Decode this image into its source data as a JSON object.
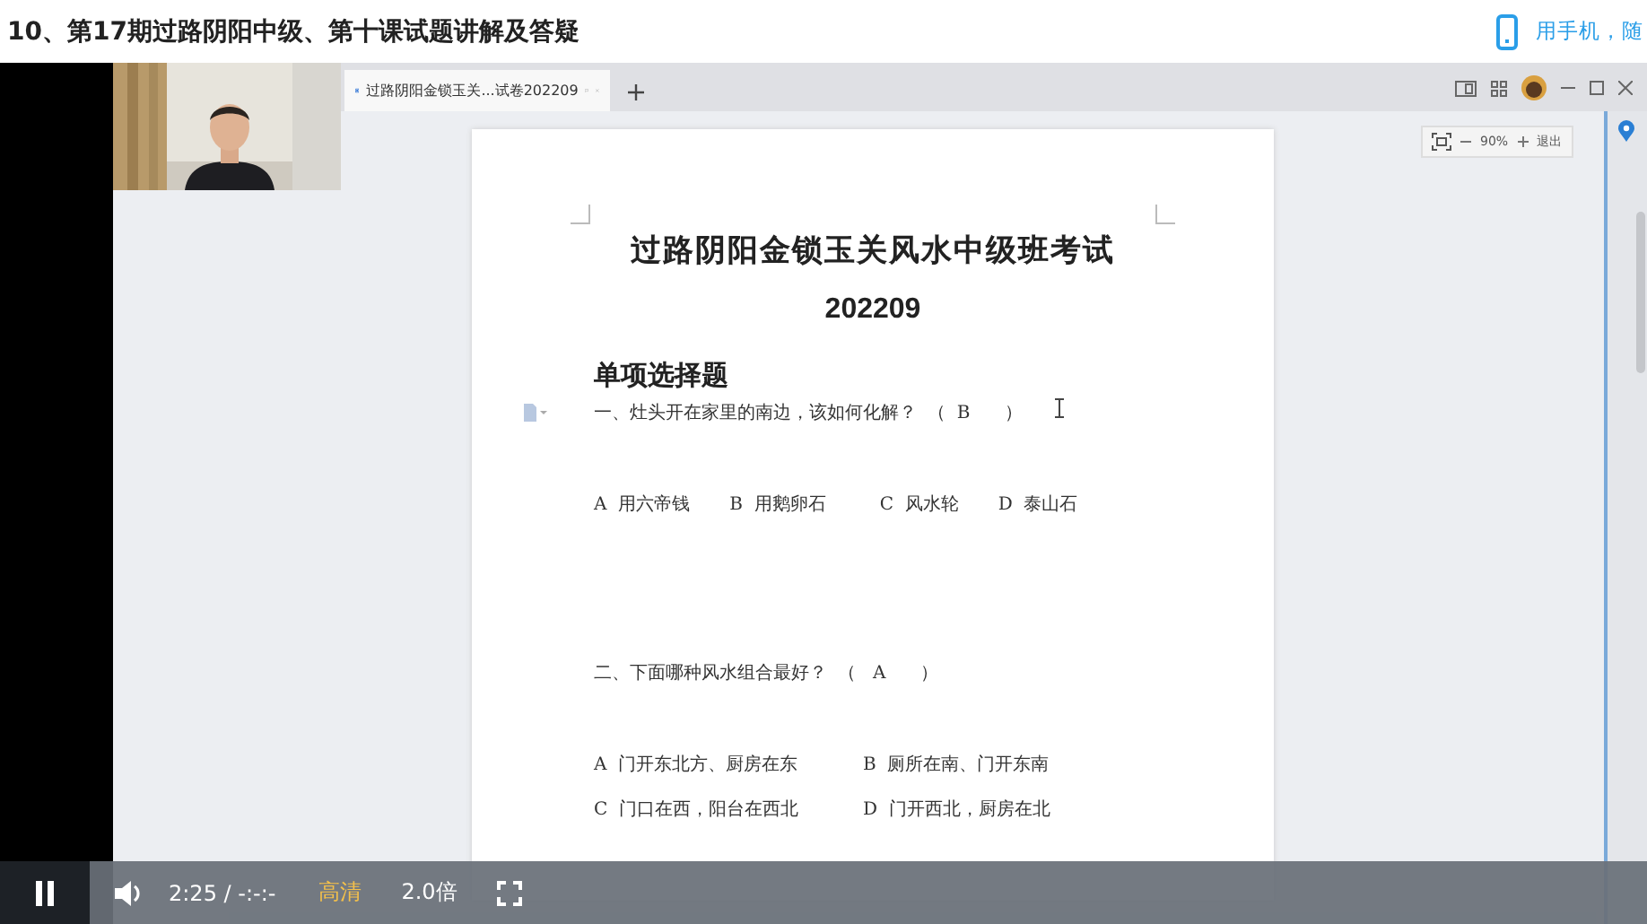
{
  "header": {
    "title": "10、第17期过路阴阳中级、第十课试题讲解及答疑",
    "mobile_link": "用手机，随"
  },
  "screen": {
    "tab": {
      "title": "过路阴阳金锁玉关...试卷202209",
      "selected": true
    },
    "zoom": "90%",
    "exit": "退出",
    "document": {
      "title": "过路阴阳金锁玉关风水中级班考试",
      "subtitle": "202209",
      "section": "单项选择题",
      "questions": [
        {
          "kind": "row",
          "question": "一、灶头开在家里的南边，该如何化解？",
          "answer": "（  B      ）",
          "options": [
            {
              "letter": "A",
              "text": "用六帝钱"
            },
            {
              "letter": "B",
              "text": "用鹅卵石"
            },
            {
              "letter": "C",
              "text": "风水轮"
            },
            {
              "letter": "D",
              "text": "泰山石"
            }
          ]
        },
        {
          "kind": "grid",
          "question": "二、下面哪种风水组合最好？",
          "answer": "（   A      ）",
          "options": [
            {
              "letter": "A",
              "text": "门开东北方、厨房在东"
            },
            {
              "letter": "B",
              "text": "厕所在南、门开东南"
            },
            {
              "letter": "C",
              "text": "门口在西，阳台在西北"
            },
            {
              "letter": "D",
              "text": "门开西北，厨房在北"
            }
          ]
        }
      ]
    }
  },
  "player": {
    "playing": true,
    "time": "2:25 / -:-:-",
    "quality": "高清",
    "speed": "2.0倍"
  }
}
